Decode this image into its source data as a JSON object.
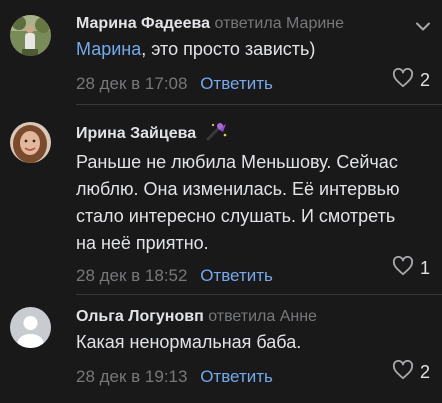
{
  "comments": [
    {
      "author": "Марина Фадеева",
      "reply_info": "ответила Марине",
      "mention": "Марина",
      "text": ", это просто зависть)",
      "date": "28 дек в 17:08",
      "reply_label": "Ответить",
      "likes": "2"
    },
    {
      "author": "Ирина Зайцева",
      "lines": [
        "Раньше не любила Меньшову. Сейчас",
        "люблю. Она изменилась. Её интервью",
        "стало интересно слушать. И смотреть",
        "на неё приятно."
      ],
      "date": "28 дек в 18:52",
      "reply_label": "Ответить",
      "likes": "1"
    },
    {
      "author": "Ольга Логуновп",
      "reply_info": "ответила Анне",
      "text": "Какая ненормальная баба.",
      "date": "28 дек в 19:13",
      "reply_label": "Ответить",
      "likes": "2"
    }
  ],
  "colors": {
    "background": "#19191a",
    "text": "#e1e3e6",
    "secondary": "#76787a",
    "accent": "#71aaeb"
  },
  "icons": [
    "chevron-down-icon",
    "heart-icon",
    "wand-emoji-icon"
  ]
}
